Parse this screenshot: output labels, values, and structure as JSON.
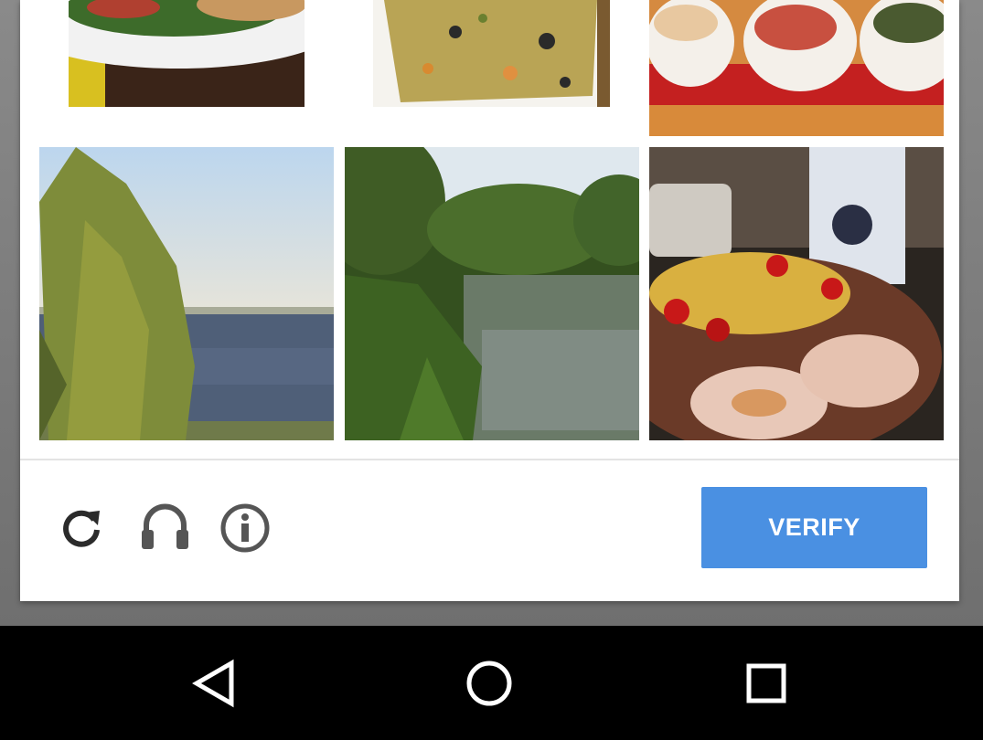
{
  "captcha": {
    "tiles": [
      {
        "row": 1,
        "col": 1,
        "subject": "sandwich-plate"
      },
      {
        "row": 1,
        "col": 2,
        "subject": "grain-salad"
      },
      {
        "row": 1,
        "col": 3,
        "subject": "bowls-on-tray"
      },
      {
        "row": 2,
        "col": 1,
        "subject": "tree-by-lake"
      },
      {
        "row": 2,
        "col": 2,
        "subject": "pond-with-trees"
      },
      {
        "row": 2,
        "col": 3,
        "subject": "food-platter"
      }
    ],
    "footer": {
      "reload_icon": "reload-icon",
      "audio_icon": "headphones-icon",
      "info_icon": "info-icon",
      "verify_label": "VERIFY"
    }
  },
  "navbar": {
    "back_icon": "back-triangle-icon",
    "home_icon": "home-circle-icon",
    "recents_icon": "recents-square-icon"
  },
  "colors": {
    "verify_bg": "#4a90e2",
    "navbar_bg": "#000000",
    "card_bg": "#ffffff",
    "icon_gray": "#555555"
  }
}
